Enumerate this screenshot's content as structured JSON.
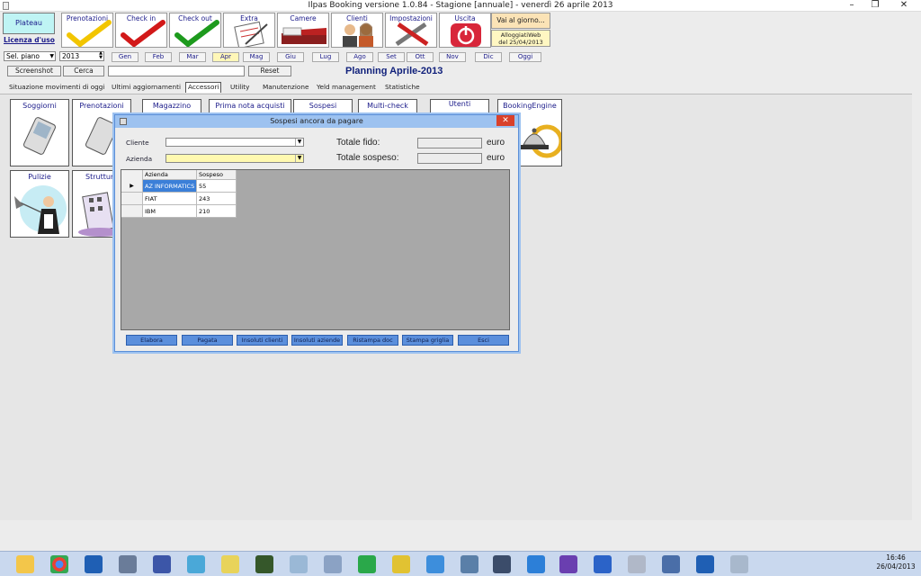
{
  "window": {
    "title": "Ilpas Booking versione 1.0.84 - Stagione [annuale] - venerdì 26 aprile 2013",
    "controls": [
      "–",
      "❐",
      "✕"
    ]
  },
  "toolbar": {
    "plateau": "Plateau",
    "licenza": "Licenza d'uso",
    "buttons": [
      {
        "label": "Prenotazioni",
        "icon": "yellow-check-icon"
      },
      {
        "label": "Check in",
        "icon": "red-check-icon"
      },
      {
        "label": "Check out",
        "icon": "green-check-icon"
      },
      {
        "label": "Extra",
        "icon": "notepad-icon"
      },
      {
        "label": "Camere",
        "icon": "bed-icon"
      },
      {
        "label": "Clienti",
        "icon": "people-icon"
      },
      {
        "label": "Impostazioni",
        "icon": "tools-icon"
      },
      {
        "label": "Uscita",
        "icon": "power-icon"
      }
    ],
    "vai": "Vai al giorno...",
    "alloggiati_line1": "AlloggiatiWeb",
    "alloggiati_line2": "del 25/04/2013"
  },
  "row2": {
    "sel_piano": "Sel. piano",
    "year": "2013",
    "months": [
      "Gen",
      "Feb",
      "Mar",
      "Apr",
      "Mag",
      "Giu",
      "Lug",
      "Ago",
      "Set",
      "Ott",
      "Nov",
      "Dic",
      "Oggi"
    ],
    "active_month": "Apr"
  },
  "row3": {
    "screenshot": "Screenshot",
    "cerca": "Cerca",
    "search_value": "",
    "reset": "Reset",
    "planning": "Planning Aprile-2013"
  },
  "tabs": [
    "Situazione movimenti di oggi",
    "Ultimi aggiornamenti",
    "Accessori",
    "Utility",
    "Manutenzione",
    "Yeld management",
    "Statistiche"
  ],
  "active_tab": "Accessori",
  "tiles": [
    {
      "label": "Soggiorni",
      "icon": "phone-icon"
    },
    {
      "label": "Prenotazioni",
      "icon": "phone-icon"
    },
    {
      "label": "Magazzino",
      "icon": "warehouse-icon"
    },
    {
      "label": "Prima nota acquisti",
      "icon": "ledger-icon"
    },
    {
      "label": "Sospesi",
      "icon": "pending-icon"
    },
    {
      "label": "Multi-check",
      "icon": "multicheck-icon"
    },
    {
      "label": "Utenti",
      "icon": "users-icon"
    },
    {
      "label": "BookingEngine",
      "icon": "bell-icon"
    },
    {
      "label": "Pulizie",
      "icon": "maid-icon"
    },
    {
      "label": "Strutture",
      "icon": "building-icon"
    }
  ],
  "dialog": {
    "title": "Sospesi ancora da pagare",
    "close": "✕",
    "cliente_label": "Cliente",
    "azienda_label": "Azienda",
    "cliente_value": "",
    "azienda_value": "",
    "totale_fido_label": "Totale fido:",
    "totale_sospeso_label": "Totale sospeso:",
    "totale_fido_value": "",
    "totale_sospeso_value": "",
    "euro": "euro",
    "grid": {
      "columns": [
        "Azienda",
        "Sospeso"
      ],
      "rows": [
        {
          "azienda": "AZ INFORMATICS",
          "sospeso": "55",
          "selected": true
        },
        {
          "azienda": "FIAT",
          "sospeso": "243",
          "selected": false
        },
        {
          "azienda": "IBM",
          "sospeso": "210",
          "selected": false
        }
      ]
    },
    "buttons": [
      "Elabora",
      "Pagata",
      "Insoluti clienti",
      "Insoluti aziende",
      "Ristampa doc",
      "Stampa griglia",
      "Esci"
    ]
  },
  "taskbar": {
    "time": "16:46",
    "date": "26/04/2013"
  }
}
